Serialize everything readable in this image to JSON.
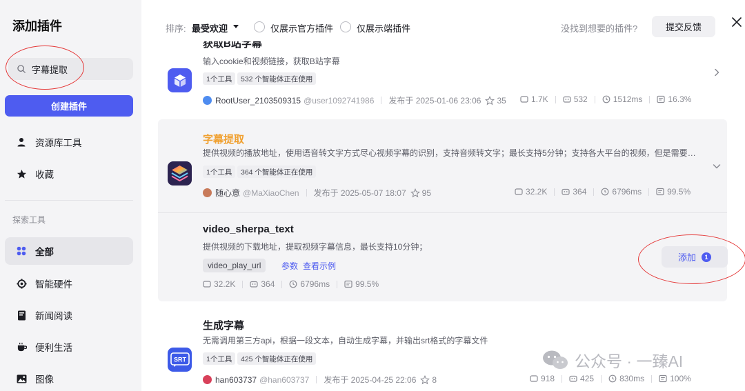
{
  "sidebar": {
    "title": "添加插件",
    "search_value": "字幕提取",
    "create_label": "创建插件",
    "items": [
      {
        "label": "资源库工具",
        "icon": "user-icon"
      },
      {
        "label": "收藏",
        "icon": "star-icon"
      }
    ],
    "section_label": "探索工具",
    "explore": [
      {
        "label": "全部",
        "icon": "grid-icon",
        "active": true
      },
      {
        "label": "智能硬件",
        "icon": "chip-icon"
      },
      {
        "label": "新闻阅读",
        "icon": "book-icon"
      },
      {
        "label": "便利生活",
        "icon": "cup-icon"
      },
      {
        "label": "图像",
        "icon": "image-icon"
      }
    ]
  },
  "topbar": {
    "sort_label": "排序:",
    "sort_value": "最受欢迎",
    "filter_official": "仅展示官方插件",
    "filter_client": "仅展示端插件",
    "not_found": "没找到想要的插件?",
    "feedback_label": "提交反馈"
  },
  "plugins": [
    {
      "title": "获取B站字幕",
      "desc": "输入cookie和视频链接，获取B站字幕",
      "tag_tools": "1个工具",
      "tag_agents": "532 个智能体正在使用",
      "author": "RootUser_2103509315",
      "handle": "@user1092741986",
      "published": "发布于 2025-01-06 23:06",
      "favorites": "35",
      "stats": {
        "calls": "1.7K",
        "bots": "532",
        "latency": "1512ms",
        "success": "16.3%"
      },
      "accent": "#4e5cf0"
    },
    {
      "title": "字幕提取",
      "desc": "提供视频的播放地址，使用语音转文字方式尽心视频字幕的识别，支持音频转文字；最长支持5分钟；支持各大平台的视频，但是需要提供…",
      "tag_tools": "1个工具",
      "tag_agents": "364 个智能体正在使用",
      "author": "随心意",
      "handle": "@MaXiaoChen",
      "published": "发布于 2025-05-07 18:07",
      "favorites": "95",
      "stats": {
        "calls": "32.2K",
        "bots": "364",
        "latency": "6796ms",
        "success": "99.5%"
      },
      "title_color": "#f0a030"
    },
    {
      "title": "生成字幕",
      "desc": "无需调用第三方api，根据一段文本，自动生成字幕，并输出srt格式的字幕文件",
      "tag_tools": "1个工具",
      "tag_agents": "425 个智能体正在使用",
      "author": "han603737",
      "handle": "@han603737",
      "published": "发布于 2025-04-25 22:06",
      "favorites": "8",
      "stats": {
        "calls": "918",
        "bots": "425",
        "latency": "830ms",
        "success": "100%"
      },
      "logo_text": "SRT"
    }
  ],
  "tool": {
    "name": "video_sherpa_text",
    "desc": "提供视频的下载地址，提取视频字幕信息，最长支持10分钟；",
    "param": "video_play_url",
    "link_params": "参数",
    "link_example": "查看示例",
    "stats": {
      "calls": "32.2K",
      "bots": "364",
      "latency": "6796ms",
      "success": "99.5%"
    },
    "add_label": "添加",
    "add_count": "1"
  },
  "watermark": "公众号 · 一臻AI"
}
